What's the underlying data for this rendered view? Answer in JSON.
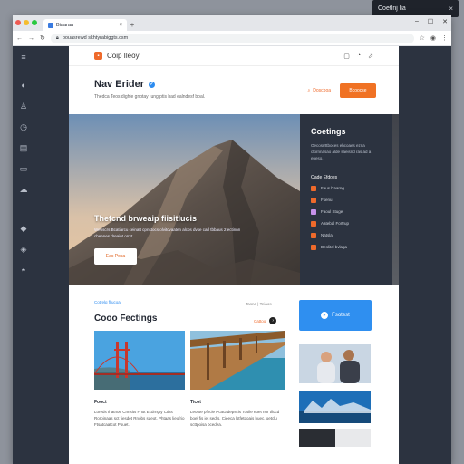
{
  "notification": {
    "text": "Coetlnj lia",
    "close": "×"
  },
  "browser": {
    "tab_title": "Biaaraa",
    "tab_close": "×",
    "new_tab": "+",
    "address": "bouasrewd skhtyrabiggts.csm",
    "window_controls": [
      "–",
      "☐",
      "✕"
    ]
  },
  "page": {
    "brand": "Coip Ileoy",
    "hero": {
      "title": "Nav Erider",
      "subtitle": "Thedca Teos dighie gnptay Iung ptis bad ealndesf boal.",
      "link_label": "Doscboa",
      "cta_label": "Bcoocse"
    },
    "banner": {
      "title": "Thetcnd brweaip fiisitlucis",
      "description": "Webscrs Bcatiarcu ceinatt cpnstocs olvitcvaaten alcos dvse carl tbbaus 2 ectinnn cbeenes dreaint orrst.",
      "button": "Eac Poca"
    },
    "panel": {
      "title": "Coetings",
      "description": "Oecosrrttboces ehcoaes ezna cfornnasao alde saeisnd ras ad a eneso.",
      "subtitle": "Oade Efdoes",
      "items": [
        {
          "label": "Faus l'taarng",
          "color": "#ef6a2b"
        },
        {
          "label": "Fsenu",
          "color": "#ef6a2b"
        },
        {
          "label": "Faoul Stuge",
          "color": "#c792ea"
        },
        {
          "label": "Aatebal Fortrup",
          "color": "#ef6a2b"
        },
        {
          "label": "Natsla",
          "color": "#ef6a2b"
        },
        {
          "label": "Deslitcl bvlaga",
          "color": "#ef6a2b"
        }
      ]
    },
    "section": {
      "eyebrow": "Cotrelg fllucoa",
      "meta": "Tasna | Teiaos",
      "title": "Cooo Fectings",
      "link": "Cattoo",
      "cards": [
        {
          "title": "Fooct",
          "text": "Loreds Ihatnoe Cnnsits Fnot Ecdrngty Ctiss Rorpinaas sct fiesdet Rnobs sdeot. Phtaas lieofrio Ftsatcaatcot Pouet."
        },
        {
          "title": "Ticot",
          "text": "Leotoe pfhcie Pcacadepscis Tosile eoet nor tllocd boel fis iet sedts. Cieeca lstfetpoais buec. oetclu scttpoisa bcedea."
        }
      ],
      "side_button": "Fsotest"
    }
  },
  "colors": {
    "accent": "#ef6a2b",
    "blue": "#2f8ff0",
    "dark": "#2c3340"
  }
}
